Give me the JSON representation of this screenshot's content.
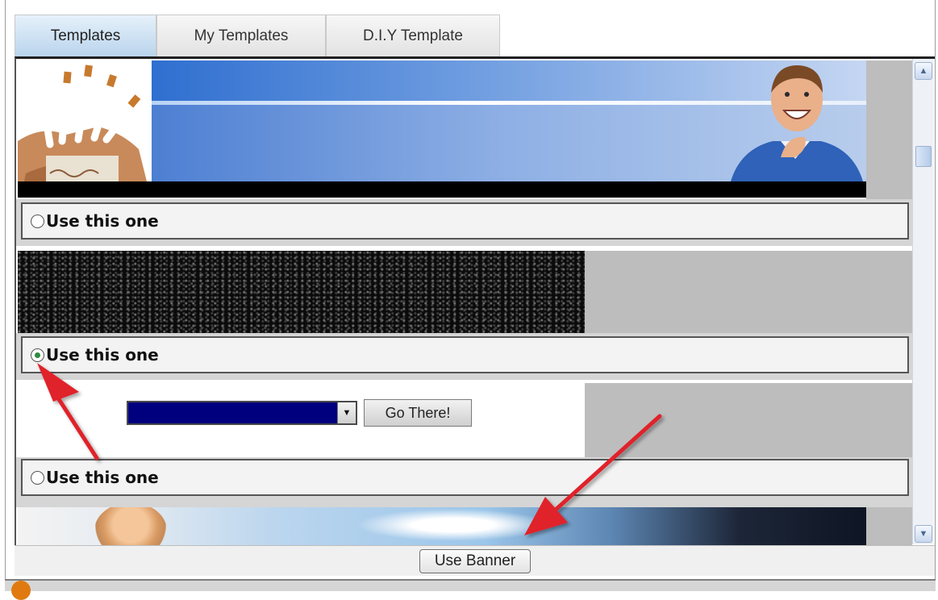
{
  "tabs": [
    {
      "label": "Templates",
      "active": true
    },
    {
      "label": "My Templates",
      "active": false
    },
    {
      "label": "D.I.Y Template",
      "active": false
    }
  ],
  "templates": [
    {
      "option_label": "Use this one",
      "selected": false
    },
    {
      "option_label": "Use this one",
      "selected": true
    },
    {
      "option_label": "Use this one",
      "selected": false
    }
  ],
  "banner3": {
    "select_value": "",
    "go_button": "Go There!"
  },
  "footer": {
    "use_banner_button": "Use Banner"
  },
  "colors": {
    "tab_active": "#b9d4ec",
    "annotation_arrow": "#e0202a",
    "select_fill": "#00007f"
  },
  "icons": {
    "scroll_up": "scroll-up-arrow",
    "scroll_down": "scroll-down-arrow",
    "dropdown": "chevron-down"
  }
}
